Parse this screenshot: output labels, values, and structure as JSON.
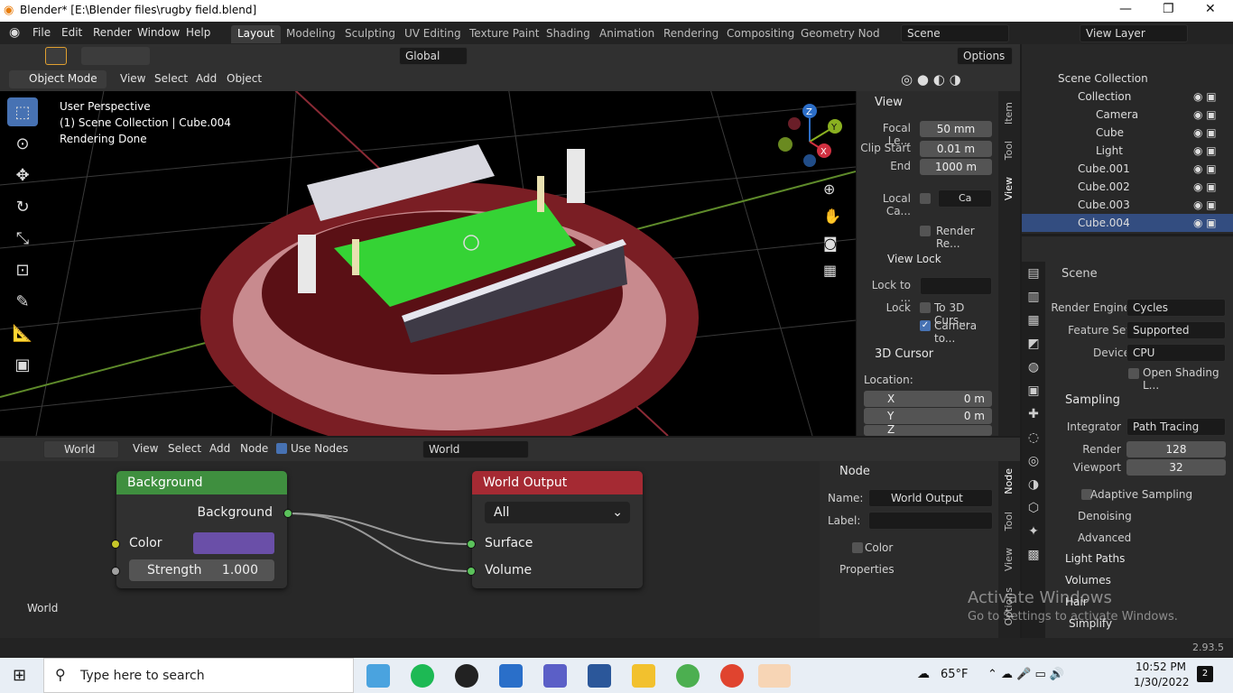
{
  "window": {
    "title": "Blender* [E:\\Blender files\\rugby field.blend]"
  },
  "menu": [
    "File",
    "Edit",
    "Render",
    "Window",
    "Help"
  ],
  "workspaces": [
    "Layout",
    "Modeling",
    "Sculpting",
    "UV Editing",
    "Texture Paint",
    "Shading",
    "Animation",
    "Rendering",
    "Compositing",
    "Geometry Nod"
  ],
  "scene_field": "Scene",
  "view_layer_field": "View Layer",
  "toolrow": {
    "orientation": "Global",
    "options": "Options"
  },
  "viewport_header": {
    "mode": "Object Mode",
    "view": "View",
    "select": "Select",
    "add": "Add",
    "object": "Object"
  },
  "overlay_text": {
    "line1": "User Perspective",
    "line2": "(1) Scene Collection | Cube.004",
    "line3": "Rendering Done"
  },
  "gizmo": {
    "z": "Z",
    "y": "Y",
    "x": "X"
  },
  "npanel": {
    "view_title": "View",
    "focal_label": "Focal Le...",
    "focal_value": "50 mm",
    "clip_start_label": "Clip Start",
    "clip_start_value": "0.01 m",
    "end_label": "End",
    "end_value": "1000 m",
    "local_cam_label": "Local Ca...",
    "local_cam_value": "Ca",
    "render_region_label": "Render Re...",
    "view_lock_title": "View Lock",
    "lock_to_label": "Lock to ...",
    "lock_label": "Lock",
    "to_3d_cursor": "To 3D Curs...",
    "camera_to": "Camera to...",
    "cursor_title": "3D Cursor",
    "location_label": "Location:",
    "x_label": "X",
    "x_value": "0 m",
    "y_label": "Y",
    "y_value": "0 m",
    "z_label": "Z"
  },
  "vtabs": [
    "Item",
    "Tool",
    "View"
  ],
  "outliner": {
    "root": "Scene Collection",
    "items": [
      "Collection",
      "Camera",
      "Cube",
      "Light",
      "Cube.001",
      "Cube.002",
      "Cube.003",
      "Cube.004"
    ]
  },
  "properties": {
    "scene_label": "Scene",
    "render_engine_label": "Render Engine",
    "render_engine_value": "Cycles",
    "feature_set_label": "Feature Set",
    "feature_set_value": "Supported",
    "device_label": "Device",
    "device_value": "CPU",
    "open_shading": "Open Shading L...",
    "sampling_title": "Sampling",
    "integrator_label": "Integrator",
    "integrator_value": "Path Tracing",
    "render_label": "Render",
    "render_value": "128",
    "viewport_label": "Viewport",
    "viewport_value": "32",
    "adaptive": "Adaptive Sampling",
    "denoising": "Denoising",
    "advanced": "Advanced",
    "light_paths": "Light Paths",
    "volumes": "Volumes",
    "hair": "Hair",
    "simplify": "Simplify"
  },
  "node_header": {
    "type": "World",
    "view": "View",
    "select": "Select",
    "add": "Add",
    "node": "Node",
    "use_nodes": "Use Nodes",
    "world_name": "World"
  },
  "nodes": {
    "background": {
      "title": "Background",
      "output": "Background",
      "color_label": "Color",
      "strength_label": "Strength",
      "strength_value": "1.000"
    },
    "world_output": {
      "title": "World Output",
      "target": "All",
      "surface": "Surface",
      "volume": "Volume"
    }
  },
  "node_corner_label": "World",
  "node_side": {
    "node_title": "Node",
    "name_label": "Name:",
    "name_value": "World Output",
    "label_label": "Label:",
    "color": "Color",
    "properties": "Properties"
  },
  "node_vtabs": [
    "Node",
    "Tool",
    "View",
    "Options"
  ],
  "watermark": {
    "line1": "Activate Windows",
    "line2": "Go to Settings to activate Windows."
  },
  "version": "2.93.5",
  "taskbar": {
    "search_placeholder": "Type here to search",
    "temperature": "65°F",
    "time": "10:52 PM",
    "date": "1/30/2022",
    "notifications": "2"
  },
  "colors": {
    "bg_color_swatch": "#6a4fa8",
    "background_header": "#3f8f3f",
    "output_header": "#a52a33",
    "grass": "#35d335"
  }
}
